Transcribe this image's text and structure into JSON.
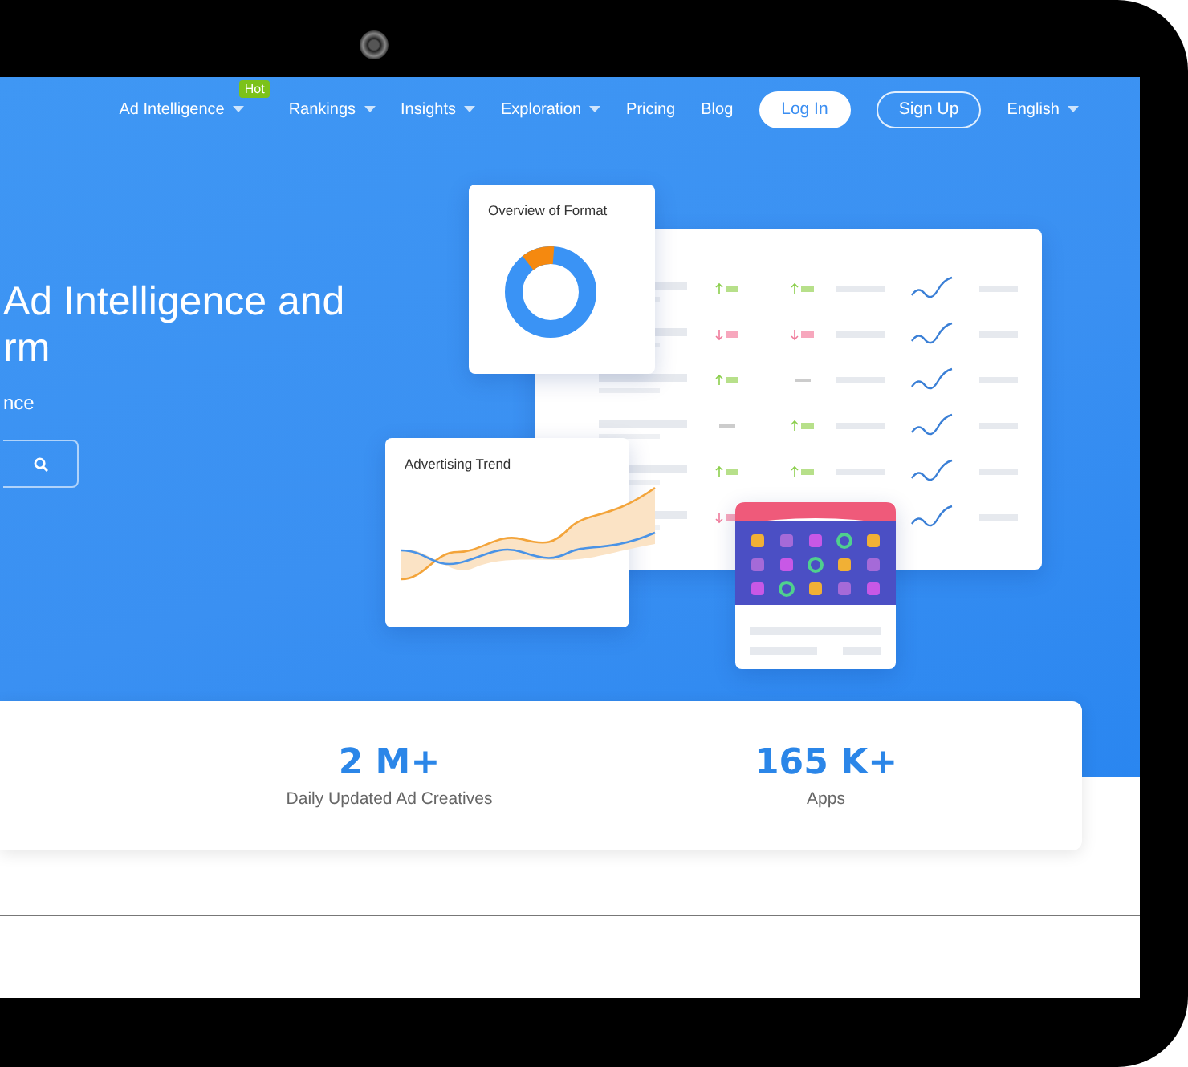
{
  "nav": {
    "items": [
      {
        "label": "Ad Intelligence",
        "dropdown": true,
        "badge": "Hot"
      },
      {
        "label": "Rankings",
        "dropdown": true
      },
      {
        "label": "Insights",
        "dropdown": true
      },
      {
        "label": "Exploration",
        "dropdown": true
      },
      {
        "label": "Pricing",
        "dropdown": false
      },
      {
        "label": "Blog",
        "dropdown": false
      }
    ],
    "buttons": [
      {
        "label": "Log In",
        "kind": "filled"
      },
      {
        "label": "Sign Up",
        "kind": "outline"
      }
    ],
    "language": {
      "label": "English",
      "dropdown": true
    }
  },
  "hero": {
    "title_lines": [
      "Ad Intelligence and",
      "rm"
    ],
    "subtitle": "nce"
  },
  "illustration": {
    "format_card": {
      "title": "Overview of Format"
    },
    "trend_card": {
      "title": "Advertising Trend"
    }
  },
  "stats": [
    {
      "value": "2 M+",
      "label": "Daily Updated Ad Creatives"
    },
    {
      "value": "165 K+",
      "label": "Apps"
    }
  ]
}
